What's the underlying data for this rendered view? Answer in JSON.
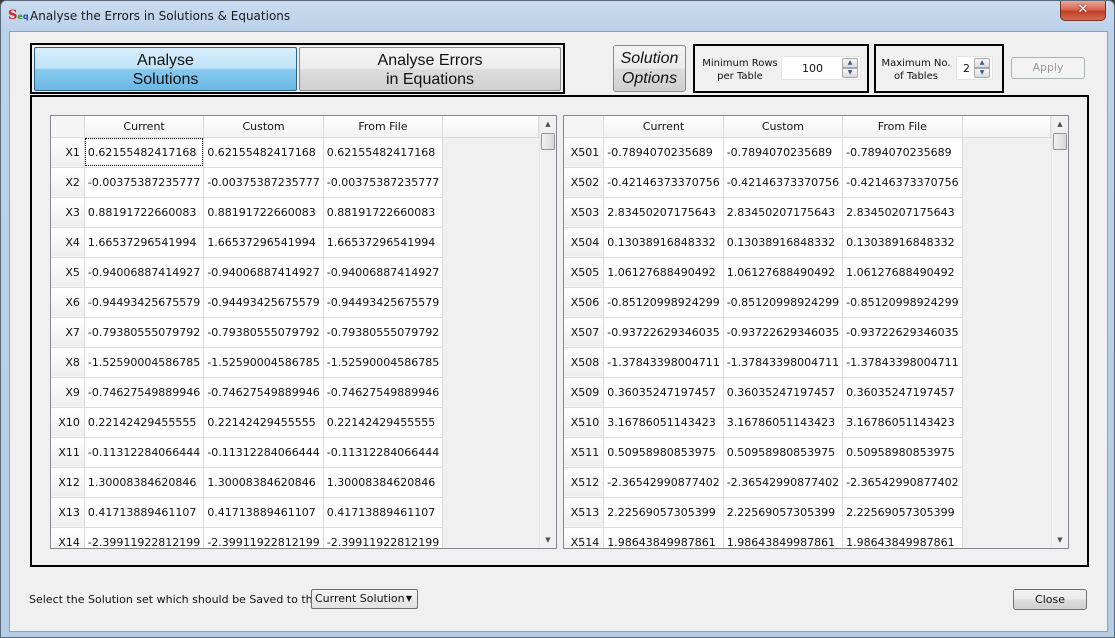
{
  "window": {
    "title": "Analyse the Errors in Solutions & Equations",
    "app_icon": {
      "main": "S",
      "sub1": "e",
      "sub2": "q"
    },
    "close_glyph": "✕"
  },
  "tabs": [
    {
      "line1": "Analyse",
      "line2": "Solutions",
      "active": true
    },
    {
      "line1": "Analyse Errors",
      "line2": "in Equations",
      "active": false
    }
  ],
  "options": {
    "solution_options": {
      "line1": "Solution",
      "line2": "Options"
    },
    "min_rows": {
      "label1": "Minimum Rows",
      "label2": "per Table",
      "value": "100"
    },
    "max_tables": {
      "label1": "Maximum No.",
      "label2": "of Tables",
      "value": "2"
    },
    "apply_label": "Apply",
    "spin_up_glyph": "▲",
    "spin_down_glyph": "▼"
  },
  "tables": [
    {
      "columns": [
        "Current",
        "Custom",
        "From File"
      ],
      "rows": [
        {
          "label": "X1",
          "values": [
            "0.62155482417168",
            "0.62155482417168",
            "0.62155482417168"
          ]
        },
        {
          "label": "X2",
          "values": [
            "-0.00375387235777",
            "-0.00375387235777",
            "-0.00375387235777"
          ]
        },
        {
          "label": "X3",
          "values": [
            "0.88191722660083",
            "0.88191722660083",
            "0.88191722660083"
          ]
        },
        {
          "label": "X4",
          "values": [
            "1.66537296541994",
            "1.66537296541994",
            "1.66537296541994"
          ]
        },
        {
          "label": "X5",
          "values": [
            "-0.94006887414927",
            "-0.94006887414927",
            "-0.94006887414927"
          ]
        },
        {
          "label": "X6",
          "values": [
            "-0.94493425675579",
            "-0.94493425675579",
            "-0.94493425675579"
          ]
        },
        {
          "label": "X7",
          "values": [
            "-0.79380555079792",
            "-0.79380555079792",
            "-0.79380555079792"
          ]
        },
        {
          "label": "X8",
          "values": [
            "-1.52590004586785",
            "-1.52590004586785",
            "-1.52590004586785"
          ]
        },
        {
          "label": "X9",
          "values": [
            "-0.74627549889946",
            "-0.74627549889946",
            "-0.74627549889946"
          ]
        },
        {
          "label": "X10",
          "values": [
            "0.22142429455555",
            "0.22142429455555",
            "0.22142429455555"
          ]
        },
        {
          "label": "X11",
          "values": [
            "-0.11312284066444",
            "-0.11312284066444",
            "-0.11312284066444"
          ]
        },
        {
          "label": "X12",
          "values": [
            "1.30008384620846",
            "1.30008384620846",
            "1.30008384620846"
          ]
        },
        {
          "label": "X13",
          "values": [
            "0.41713889461107",
            "0.41713889461107",
            "0.41713889461107"
          ]
        },
        {
          "label": "X14",
          "values": [
            "-2.39911922812199",
            "-2.39911922812199",
            "-2.39911922812199"
          ]
        }
      ]
    },
    {
      "columns": [
        "Current",
        "Custom",
        "From File"
      ],
      "rows": [
        {
          "label": "X501",
          "values": [
            "-0.7894070235689",
            "-0.7894070235689",
            "-0.7894070235689"
          ]
        },
        {
          "label": "X502",
          "values": [
            "-0.42146373370756",
            "-0.42146373370756",
            "-0.42146373370756"
          ]
        },
        {
          "label": "X503",
          "values": [
            "2.83450207175643",
            "2.83450207175643",
            "2.83450207175643"
          ]
        },
        {
          "label": "X504",
          "values": [
            "0.13038916848332",
            "0.13038916848332",
            "0.13038916848332"
          ]
        },
        {
          "label": "X505",
          "values": [
            "1.06127688490492",
            "1.06127688490492",
            "1.06127688490492"
          ]
        },
        {
          "label": "X506",
          "values": [
            "-0.85120998924299",
            "-0.85120998924299",
            "-0.85120998924299"
          ]
        },
        {
          "label": "X507",
          "values": [
            "-0.93722629346035",
            "-0.93722629346035",
            "-0.93722629346035"
          ]
        },
        {
          "label": "X508",
          "values": [
            "-1.37843398004711",
            "-1.37843398004711",
            "-1.37843398004711"
          ]
        },
        {
          "label": "X509",
          "values": [
            "0.36035247197457",
            "0.36035247197457",
            "0.36035247197457"
          ]
        },
        {
          "label": "X510",
          "values": [
            "3.16786051143423",
            "3.16786051143423",
            "3.16786051143423"
          ]
        },
        {
          "label": "X511",
          "values": [
            "0.50958980853975",
            "0.50958980853975",
            "0.50958980853975"
          ]
        },
        {
          "label": "X512",
          "values": [
            "-2.36542990877402",
            "-2.36542990877402",
            "-2.36542990877402"
          ]
        },
        {
          "label": "X513",
          "values": [
            "2.22569057305399",
            "2.22569057305399",
            "2.22569057305399"
          ]
        },
        {
          "label": "X514",
          "values": [
            "1.98643849987861",
            "1.98643849987861",
            "1.98643849987861"
          ]
        }
      ]
    }
  ],
  "scroll": {
    "up_glyph": "▲",
    "down_glyph": "▼"
  },
  "footer": {
    "save_label": "Select the Solution set which should be Saved to the File:",
    "save_selected": "Current Solution",
    "caret_glyph": "▼",
    "close_label": "Close"
  }
}
